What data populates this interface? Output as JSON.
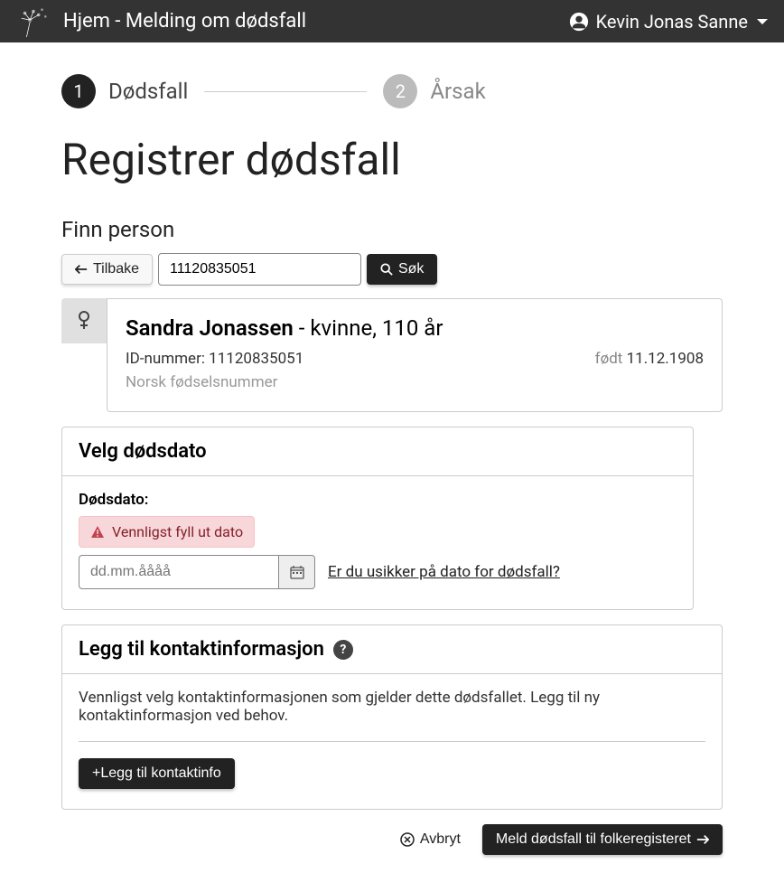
{
  "header": {
    "title": "Hjem - Melding om dødsfall",
    "user_name": "Kevin Jonas Sanne"
  },
  "stepper": {
    "steps": [
      {
        "number": "1",
        "label": "Dødsfall",
        "active": true
      },
      {
        "number": "2",
        "label": "Årsak",
        "active": false
      }
    ]
  },
  "page_title": "Registrer dødsfall",
  "find_person": {
    "title": "Finn person",
    "back_label": "Tilbake",
    "search_value": "11120835051",
    "search_button": "Søk"
  },
  "person": {
    "name": "Sandra Jonassen",
    "meta": " - kvinne, 110 år",
    "id_label": "ID-nummer: ",
    "id_value": "11120835051",
    "born_label": "født ",
    "born_date": "11.12.1908",
    "id_type": "Norsk fødselsnummer"
  },
  "death_date": {
    "panel_title": "Velg dødsdato",
    "field_label": "Dødsdato:",
    "alert_text": "Vennligst fyll ut dato",
    "placeholder": "dd.mm.åååå",
    "unsure_link": "Er du usikker på dato for dødsfall?"
  },
  "contact": {
    "panel_title": "Legg til kontaktinformasjon",
    "description": "Vennligst velg kontaktinformasjonen som gjelder dette dødsfallet. Legg til ny kontaktinformasjon ved behov.",
    "add_button": "+Legg til kontaktinfo"
  },
  "footer": {
    "cancel_label": "Avbryt",
    "submit_label": "Meld dødsfall til folkeregisteret"
  }
}
